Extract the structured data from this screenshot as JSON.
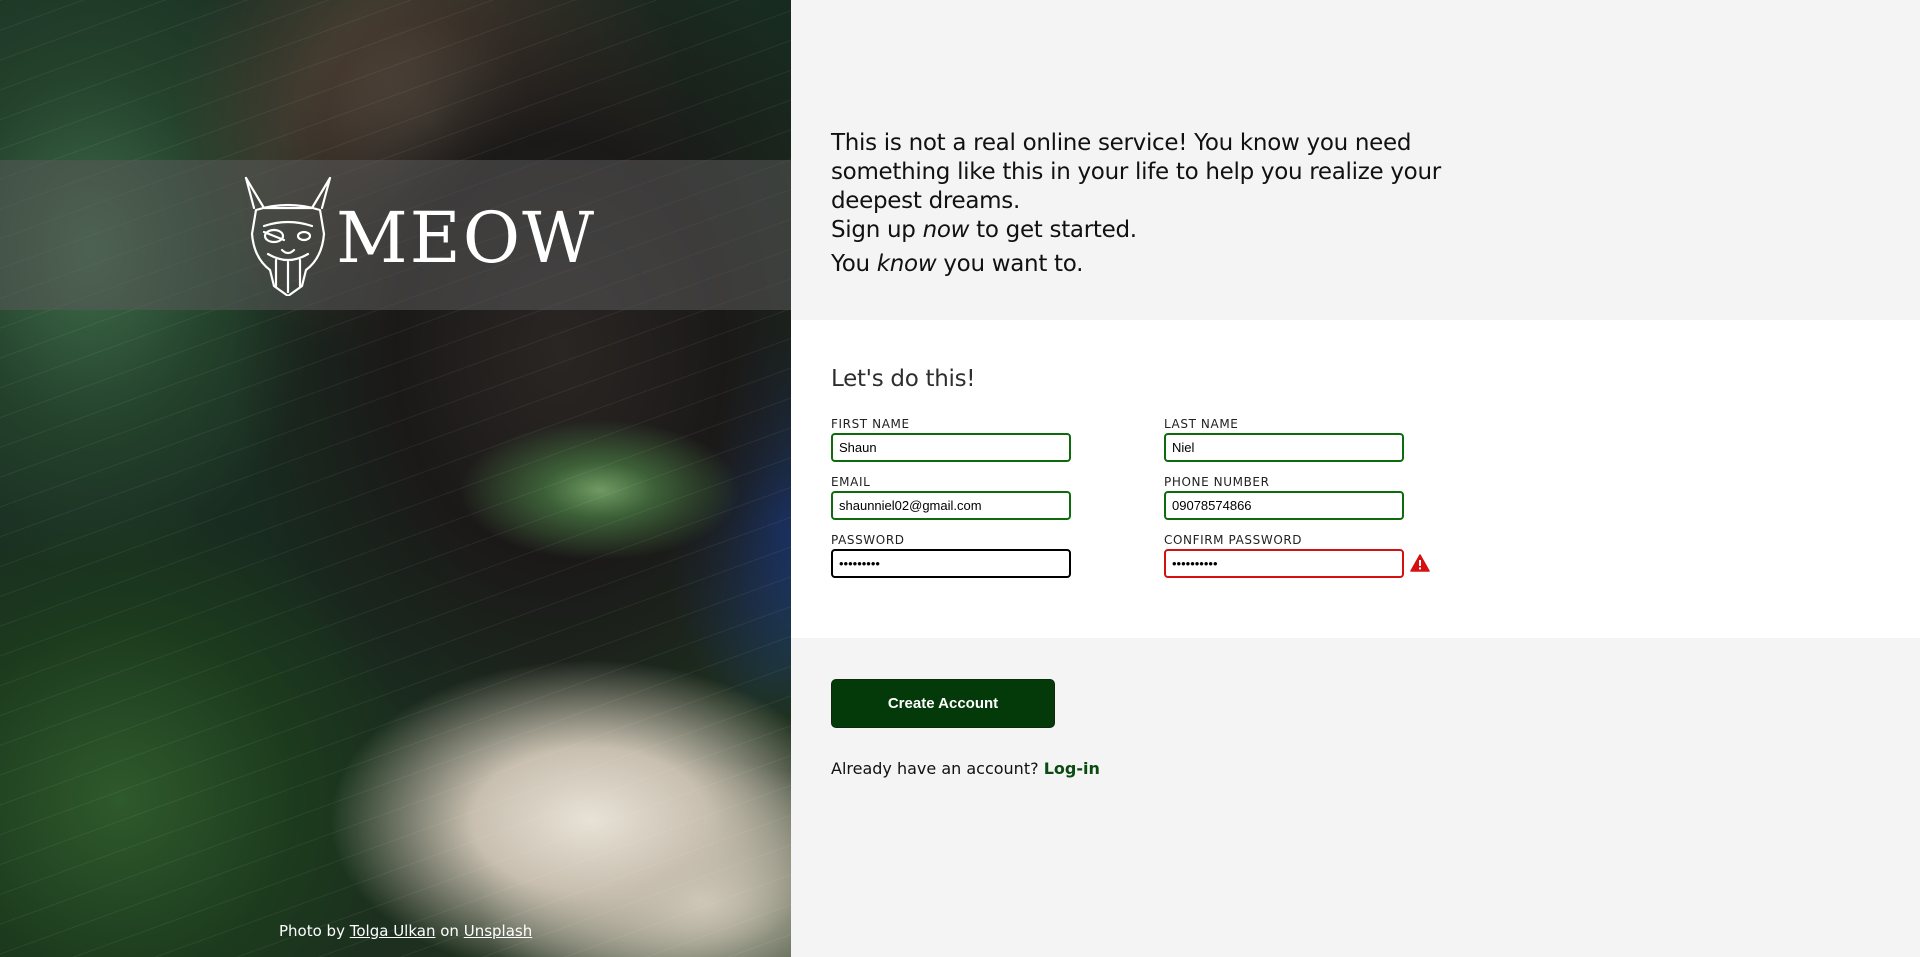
{
  "brand": {
    "logo_text": "MEOW",
    "logo_icon": "cat-viking-head-icon"
  },
  "photo_credit": {
    "prefix": "Photo by",
    "author": "Tolga Ulkan",
    "middle": "on",
    "site": "Unsplash"
  },
  "intro": {
    "line1": "This is not a real online service! You know you need something like this in your life to help you realize your deepest dreams.",
    "signup_prefix": "Sign up",
    "signup_emphasis": "now",
    "signup_suffix": "to get started.",
    "know_prefix": "You",
    "know_emphasis": "know",
    "know_suffix": "you want to."
  },
  "form": {
    "heading": "Let's do this!",
    "first_name": {
      "label": "FIRST NAME",
      "value": "Shaun"
    },
    "last_name": {
      "label": "LAST NAME",
      "value": "Niel"
    },
    "email": {
      "label": "EMAIL",
      "value": "shaunniel02@gmail.com"
    },
    "phone": {
      "label": "PHONE NUMBER",
      "value": "09078574866"
    },
    "password": {
      "label": "PASSWORD",
      "value": "*********"
    },
    "confirm_password": {
      "label": "CONFIRM PASSWORD",
      "value": "**********",
      "status_icon": "warning-icon"
    }
  },
  "actions": {
    "create_label": "Create Account",
    "login_prompt": "Already have an account?",
    "login_link": "Log-in"
  },
  "colors": {
    "valid_border": "#0d6b0d",
    "invalid_border": "#d41010",
    "button_bg": "#043a0a",
    "link": "#0b4a10"
  }
}
